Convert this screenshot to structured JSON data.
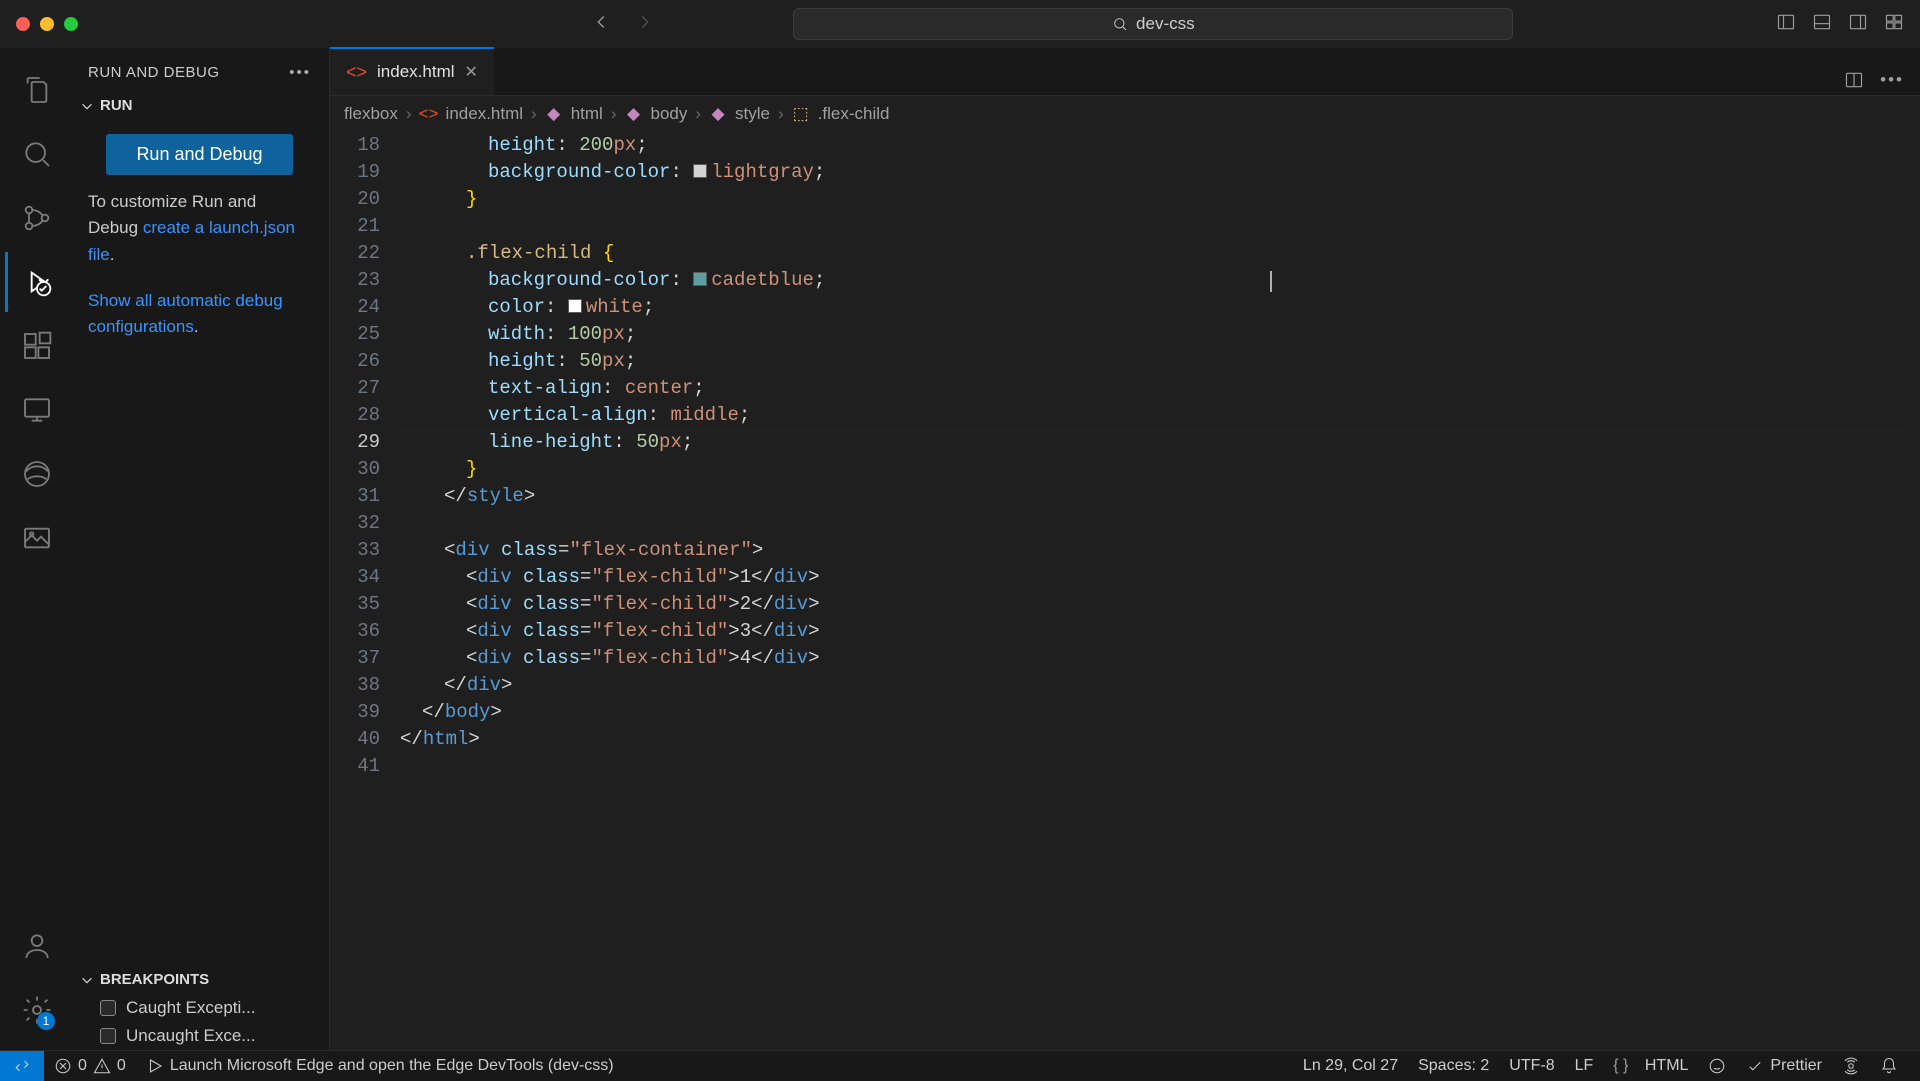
{
  "titlebar": {
    "project": "dev-css"
  },
  "activitybar": {
    "settingsBadge": "1"
  },
  "sidebar": {
    "title": "RUN AND DEBUG",
    "runSection": "RUN",
    "runAndDebugButton": "Run and Debug",
    "customizeText1": "To customize Run and Debug ",
    "customizeLink": "create a launch.json file",
    "customizePunct": ".",
    "showConfigsText": "Show all automatic debug configurations",
    "showConfigsPunct": ".",
    "breakpointsHeader": "BREAKPOINTS",
    "bp1": "Caught Excepti...",
    "bp2": "Uncaught Exce..."
  },
  "tabs": {
    "file": "index.html"
  },
  "breadcrumb": {
    "parts": [
      "flexbox",
      "index.html",
      "html",
      "body",
      "style",
      ".flex-child"
    ]
  },
  "gutter": {
    "start": 18,
    "end": 41,
    "activeLine": 29
  },
  "code": {
    "l18": {
      "prop": "height",
      "val": "200px"
    },
    "l19": {
      "prop": "background-color",
      "val": "lightgray",
      "swatch": "#d3d3d3"
    },
    "l22": {
      "sel": ".flex-child"
    },
    "l23": {
      "prop": "background-color",
      "val": "cadetblue",
      "swatch": "#5f9ea0"
    },
    "l24": {
      "prop": "color",
      "val": "white",
      "swatch": "#ffffff"
    },
    "l25": {
      "prop": "width",
      "val": "100px"
    },
    "l26": {
      "prop": "height",
      "val": "50px"
    },
    "l27": {
      "prop": "text-align",
      "val": "center"
    },
    "l28": {
      "prop": "vertical-align",
      "val": "middle"
    },
    "l29": {
      "prop": "line-height",
      "val": "50px"
    },
    "l31": {
      "tag": "style"
    },
    "l33": {
      "tag": "div",
      "attr": "class",
      "str": "flex-container"
    },
    "l34": {
      "tag": "div",
      "attr": "class",
      "str": "flex-child",
      "text": "1"
    },
    "l35": {
      "tag": "div",
      "attr": "class",
      "str": "flex-child",
      "text": "2"
    },
    "l36": {
      "tag": "div",
      "attr": "class",
      "str": "flex-child",
      "text": "3"
    },
    "l37": {
      "tag": "div",
      "attr": "class",
      "str": "flex-child",
      "text": "4"
    },
    "l38": {
      "tag": "div"
    },
    "l39": {
      "tag": "body"
    },
    "l40": {
      "tag": "html"
    }
  },
  "statusbar": {
    "errors": "0",
    "warnings": "0",
    "launch": "Launch Microsoft Edge and open the Edge DevTools (dev-css)",
    "lineCol": "Ln 29, Col 27",
    "spaces": "Spaces: 2",
    "encoding": "UTF-8",
    "eol": "LF",
    "language": "HTML",
    "prettier": "Prettier"
  }
}
